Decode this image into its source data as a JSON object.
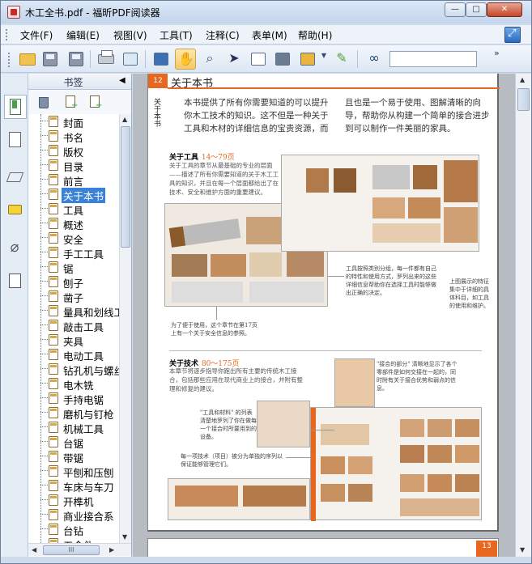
{
  "window": {
    "title": "木工全书.pdf - 福昕PDF阅读器",
    "minimize_label": "—",
    "maximize_label": "□",
    "close_label": "✕"
  },
  "menu": {
    "items": [
      "文件(F)",
      "编辑(E)",
      "视图(V)",
      "工具(T)",
      "注释(C)",
      "表单(M)",
      "帮助(H)"
    ]
  },
  "toolbar": {
    "search_placeholder": "",
    "more_label": "»",
    "tools": [
      "open",
      "save",
      "save-as",
      "print",
      "scan",
      "full-screen",
      "hand",
      "zoom",
      "select",
      "text-select",
      "snapshot",
      "rms",
      "sign",
      "find"
    ]
  },
  "bookmarks": {
    "title": "书签",
    "collapse_label": "◀",
    "tools": [
      "delete-icon",
      "add-bookmark-icon",
      "add-child-bookmark-icon"
    ],
    "selected_index": 5,
    "items": [
      "封面",
      "书名",
      "版权",
      "目录",
      "前言",
      "关于本书",
      "工具",
      "概述",
      "安全",
      "手工工具",
      "锯",
      "刨子",
      "凿子",
      "量具和划线工",
      "敲击工具",
      "夹具",
      "电动工具",
      "钻孔机与螺丝",
      "电木铣",
      "手持电锯",
      "磨机与钉枪",
      "机械工具",
      "台锯",
      "带锯",
      "平刨和压刨",
      "车床与车刀",
      "开榫机",
      "商业接合系",
      "台钻",
      "五金件"
    ],
    "hscroll_label": "III"
  },
  "document": {
    "page_number": "12",
    "page_title": "关于本书",
    "side_tag": "关于本书",
    "intro": "本书提供了所有你需要知道的可以提升你木工技术的知识。这不但是一种关于工具和木材的详细信息的宝贵资源，而且也是一个易于使用、图解清晰的向导，帮助你从构建一个简单的接合进步到可以制作一件美丽的家具。",
    "sections": [
      {
        "title": "关于工具",
        "range": "14～79页",
        "text": "关于工具的章节从最基础的专业的层面——描述了所有你需要知道的关于木工工具的知识，并且在每一个层面都给出了在技术、安全和维护方面的重要建议。"
      },
      {
        "title": "关于技术",
        "range": "80～175页",
        "text": "本章节将逐步指导你跑出所有主要的传统木工接合，包括那些应用在现代商业上的接合，并附有整理和修复的建议。"
      }
    ],
    "captions": {
      "tools_right": "工具按照类别分组，每一件都有自己的特性和使用方式，罗列出来的这些详细信息帮助你在选择工具时能够做出正确的决定。",
      "tools_far_right": "上图展示的特征集中于详细的具体科目，如工具的使用和维护。",
      "tools_bottom": "为了便于使用，这个章节在第17页上有一个关于安全信息的参照。",
      "tech_quote": "\"接合的部分\" 清晰地显示了各个零部件是如何交接在一起的，同时附有关于接合优势和弱点的信息。",
      "tech_materials": "\"工具和材料\" 的列表清楚地罗列了你在做每一个接合时所要用到的设备。",
      "tech_steps": "每一项技术（项目）被分为单独的序列以保证能够管理它们。"
    },
    "next_page_number": "13"
  },
  "colors": {
    "accent": "#e8671f",
    "selection": "#3a82d6",
    "chrome": "#cfdcec"
  }
}
